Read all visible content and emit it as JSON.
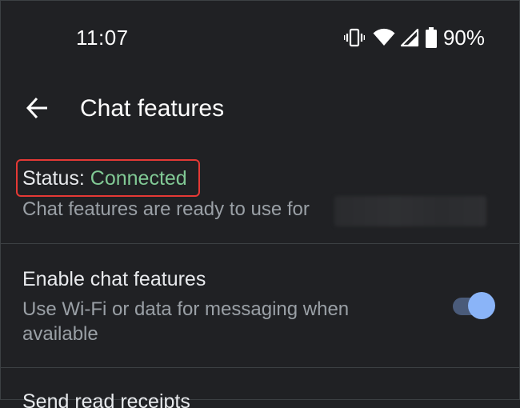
{
  "status_bar": {
    "time": "11:07",
    "icons": [
      "vibrate-icon",
      "wifi-icon",
      "cell-signal-icon",
      "battery-icon"
    ],
    "battery_percent": "90%"
  },
  "app_bar": {
    "back_icon": "arrow-back-icon",
    "title": "Chat features"
  },
  "status": {
    "label": "Status:",
    "value": "Connected",
    "value_color": "#81c995",
    "highlight_color": "#e53935",
    "description": "Chat features are ready to use for"
  },
  "enable_chat": {
    "title": "Enable chat features",
    "description": "Use Wi-Fi or data for messaging when available",
    "enabled": true,
    "accent_color": "#8ab4f8"
  },
  "next_setting": {
    "title": "Send read receipts"
  }
}
